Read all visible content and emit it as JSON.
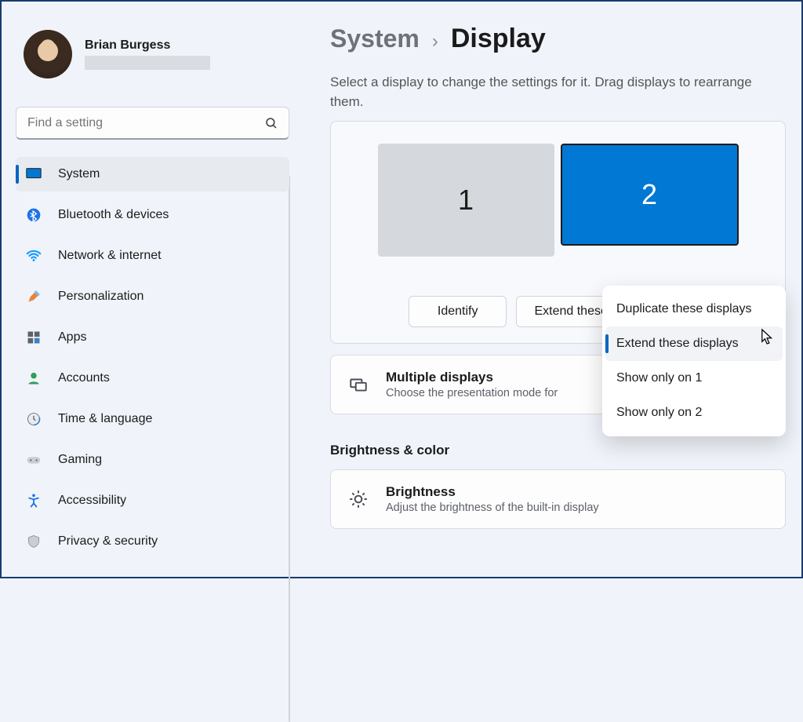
{
  "user": {
    "name": "Brian Burgess"
  },
  "search": {
    "placeholder": "Find a setting"
  },
  "sidebar": {
    "items": [
      {
        "label": "System"
      },
      {
        "label": "Bluetooth & devices"
      },
      {
        "label": "Network & internet"
      },
      {
        "label": "Personalization"
      },
      {
        "label": "Apps"
      },
      {
        "label": "Accounts"
      },
      {
        "label": "Time & language"
      },
      {
        "label": "Gaming"
      },
      {
        "label": "Accessibility"
      },
      {
        "label": "Privacy & security"
      }
    ]
  },
  "breadcrumb": {
    "parent": "System",
    "separator": "›",
    "current": "Display"
  },
  "help": "Select a display to change the settings for it. Drag displays to rearrange them.",
  "displays": {
    "one": "1",
    "two": "2"
  },
  "actions": {
    "identify": "Identify",
    "mode_selected": "Extend these displays"
  },
  "dropdown": {
    "items": [
      "Duplicate these displays",
      "Extend these displays",
      "Show only on 1",
      "Show only on 2"
    ]
  },
  "cards": {
    "multiple": {
      "title": "Multiple displays",
      "sub": "Choose the presentation mode for"
    },
    "brightness_section": "Brightness & color",
    "brightness": {
      "title": "Brightness",
      "sub": "Adjust the brightness of the built-in display"
    }
  }
}
